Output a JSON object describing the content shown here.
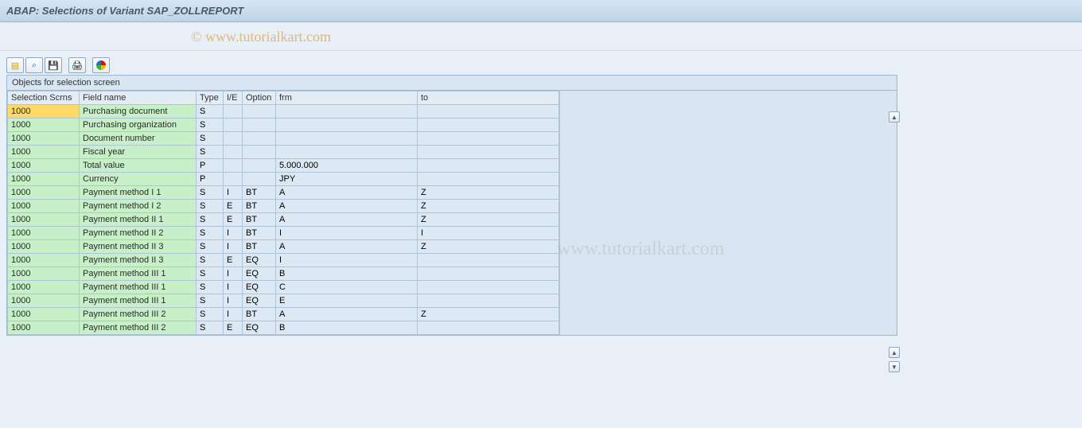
{
  "header": {
    "title": "ABAP: Selections of Variant SAP_ZOLLREPORT"
  },
  "watermark1": "© www.tutorialkart.com",
  "watermark2": "www.tutorialkart.com",
  "panel": {
    "title": "Objects for selection screen",
    "columns": {
      "scr": "Selection Scrns",
      "field": "Field name",
      "type": "Type",
      "ie": "I/E",
      "option": "Option",
      "frm": "frm",
      "to": "to"
    },
    "rows": [
      {
        "scr": "1000",
        "selected": true,
        "field": "Purchasing document",
        "type": "S",
        "ie": "",
        "option": "",
        "frm": "",
        "to": ""
      },
      {
        "scr": "1000",
        "field": "Purchasing organization",
        "type": "S",
        "ie": "",
        "option": "",
        "frm": "",
        "to": ""
      },
      {
        "scr": "1000",
        "field": "Document number",
        "type": "S",
        "ie": "",
        "option": "",
        "frm": "",
        "to": ""
      },
      {
        "scr": "1000",
        "field": "Fiscal year",
        "type": "S",
        "ie": "",
        "option": "",
        "frm": "",
        "to": ""
      },
      {
        "scr": "1000",
        "field": "Total value",
        "type": "P",
        "ie": "",
        "option": "",
        "frm": "5.000.000",
        "to": ""
      },
      {
        "scr": "1000",
        "field": "Currency",
        "type": "P",
        "ie": "",
        "option": "",
        "frm": "JPY",
        "to": ""
      },
      {
        "scr": "1000",
        "field": "Payment method I 1",
        "type": "S",
        "ie": "I",
        "option": "BT",
        "frm": "A",
        "to": "Z"
      },
      {
        "scr": "1000",
        "field": "Payment method I 2",
        "type": "S",
        "ie": "E",
        "option": "BT",
        "frm": "A",
        "to": "Z"
      },
      {
        "scr": "1000",
        "field": "Payment method II 1",
        "type": "S",
        "ie": "E",
        "option": "BT",
        "frm": "A",
        "to": "Z"
      },
      {
        "scr": "1000",
        "field": "Payment method II 2",
        "type": "S",
        "ie": "I",
        "option": "BT",
        "frm": "I",
        "to": "I"
      },
      {
        "scr": "1000",
        "field": "Payment method II 3",
        "type": "S",
        "ie": "I",
        "option": "BT",
        "frm": "A",
        "to": "Z"
      },
      {
        "scr": "1000",
        "field": "Payment method II 3",
        "type": "S",
        "ie": "E",
        "option": "EQ",
        "frm": "I",
        "to": ""
      },
      {
        "scr": "1000",
        "field": "Payment method III 1",
        "type": "S",
        "ie": "I",
        "option": "EQ",
        "frm": "B",
        "to": ""
      },
      {
        "scr": "1000",
        "field": "Payment method III 1",
        "type": "S",
        "ie": "I",
        "option": "EQ",
        "frm": "C",
        "to": ""
      },
      {
        "scr": "1000",
        "field": "Payment method III 1",
        "type": "S",
        "ie": "I",
        "option": "EQ",
        "frm": "E",
        "to": ""
      },
      {
        "scr": "1000",
        "field": "Payment method III 2",
        "type": "S",
        "ie": "I",
        "option": "BT",
        "frm": "A",
        "to": "Z"
      },
      {
        "scr": "1000",
        "field": "Payment method III 2",
        "type": "S",
        "ie": "E",
        "option": "EQ",
        "frm": "B",
        "to": ""
      }
    ]
  }
}
